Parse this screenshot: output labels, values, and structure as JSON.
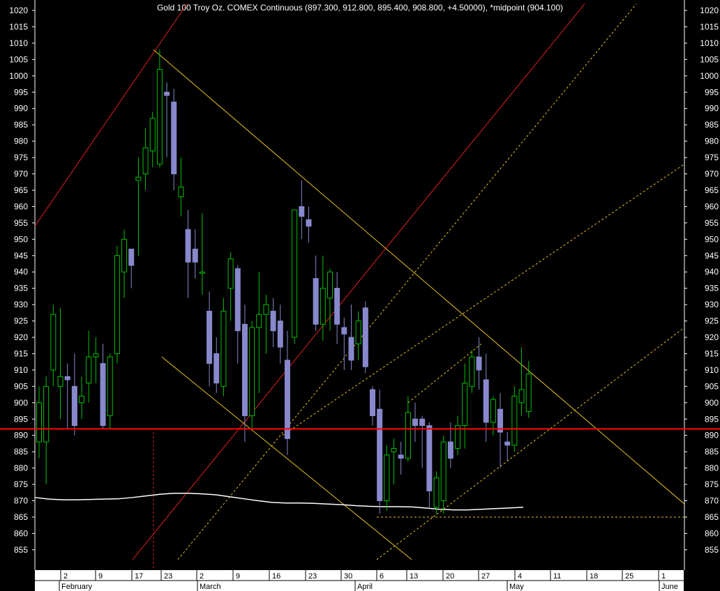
{
  "title": "Gold 100 Troy Oz. COMEX Continuous (897.300, 912.800, 895.400, 908.800, +4.50000), *midpoint (904.100)",
  "colors": {
    "background": "#000000",
    "bull_candle": "#00c000",
    "bear_candle": "#8888cc",
    "support_line": "#ff0000",
    "trend_red": "#dd2020",
    "trend_yellow": "#e8c020",
    "midpoint_line": "#ffffff",
    "axis_text": "#ffffff",
    "date_bar": "#ffffff"
  },
  "chart_data": {
    "type": "candlestick",
    "title": "Gold 100 Troy Oz. COMEX Continuous (897.300, 912.800, 895.400, 908.800, +4.50000), *midpoint (904.100)",
    "ylim": [
      852,
      1022
    ],
    "y_ticks": [
      855,
      860,
      865,
      870,
      875,
      880,
      885,
      890,
      895,
      900,
      905,
      910,
      915,
      920,
      925,
      930,
      935,
      940,
      945,
      950,
      955,
      960,
      965,
      970,
      975,
      980,
      985,
      990,
      995,
      1000,
      1005,
      1010,
      1015,
      1020
    ],
    "x_day_ticks": [
      "2",
      "9",
      "17",
      "23",
      "2",
      "9",
      "16",
      "23",
      "30",
      "6",
      "13",
      "20",
      "27",
      "4",
      "11",
      "18",
      "25",
      "1"
    ],
    "x_month_labels": [
      "February",
      "March",
      "April",
      "May",
      "June"
    ],
    "support_level": 892,
    "candles": [
      {
        "o": 888,
        "h": 905,
        "l": 883,
        "c": 900
      },
      {
        "o": 888,
        "h": 908,
        "l": 875,
        "c": 905
      },
      {
        "o": 910,
        "h": 930,
        "l": 905,
        "c": 927
      },
      {
        "o": 905,
        "h": 929,
        "l": 895,
        "c": 908
      },
      {
        "o": 908,
        "h": 912,
        "l": 892,
        "c": 907
      },
      {
        "o": 905,
        "h": 915,
        "l": 890,
        "c": 893
      },
      {
        "o": 900,
        "h": 908,
        "l": 895,
        "c": 902
      },
      {
        "o": 906,
        "h": 922,
        "l": 900,
        "c": 914
      },
      {
        "o": 914,
        "h": 920,
        "l": 906,
        "c": 915
      },
      {
        "o": 912,
        "h": 918,
        "l": 892,
        "c": 893
      },
      {
        "o": 896,
        "h": 915,
        "l": 892,
        "c": 914
      },
      {
        "o": 915,
        "h": 948,
        "l": 912,
        "c": 945
      },
      {
        "o": 940,
        "h": 953,
        "l": 932,
        "c": 950
      },
      {
        "o": 947,
        "h": 947,
        "l": 935,
        "c": 942
      },
      {
        "o": 968,
        "h": 975,
        "l": 945,
        "c": 969
      },
      {
        "o": 970,
        "h": 984,
        "l": 965,
        "c": 978
      },
      {
        "o": 977,
        "h": 989,
        "l": 972,
        "c": 987
      },
      {
        "o": 973,
        "h": 1008,
        "l": 972,
        "c": 1002
      },
      {
        "o": 995,
        "h": 998,
        "l": 975,
        "c": 994
      },
      {
        "o": 992,
        "h": 996,
        "l": 965,
        "c": 970
      },
      {
        "o": 963,
        "h": 975,
        "l": 957,
        "c": 966
      },
      {
        "o": 953,
        "h": 959,
        "l": 932,
        "c": 943
      },
      {
        "o": 947,
        "h": 953,
        "l": 938,
        "c": 943
      },
      {
        "o": 940,
        "h": 958,
        "l": 933,
        "c": 940
      },
      {
        "o": 928,
        "h": 934,
        "l": 905,
        "c": 912
      },
      {
        "o": 915,
        "h": 920,
        "l": 903,
        "c": 906
      },
      {
        "o": 905,
        "h": 932,
        "l": 902,
        "c": 928
      },
      {
        "o": 935,
        "h": 946,
        "l": 925,
        "c": 944
      },
      {
        "o": 941,
        "h": 942,
        "l": 912,
        "c": 922
      },
      {
        "o": 924,
        "h": 930,
        "l": 888,
        "c": 896
      },
      {
        "o": 896,
        "h": 925,
        "l": 892,
        "c": 923
      },
      {
        "o": 923,
        "h": 940,
        "l": 903,
        "c": 927
      },
      {
        "o": 927,
        "h": 933,
        "l": 915,
        "c": 930
      },
      {
        "o": 928,
        "h": 932,
        "l": 917,
        "c": 922
      },
      {
        "o": 925,
        "h": 930,
        "l": 912,
        "c": 917
      },
      {
        "o": 913,
        "h": 922,
        "l": 884,
        "c": 889
      },
      {
        "o": 920,
        "h": 955,
        "l": 918,
        "c": 959
      },
      {
        "o": 960,
        "h": 968,
        "l": 950,
        "c": 957
      },
      {
        "o": 956,
        "h": 960,
        "l": 949,
        "c": 954
      },
      {
        "o": 938,
        "h": 945,
        "l": 922,
        "c": 924
      },
      {
        "o": 924,
        "h": 945,
        "l": 919,
        "c": 935
      },
      {
        "o": 932,
        "h": 941,
        "l": 922,
        "c": 940
      },
      {
        "o": 935,
        "h": 940,
        "l": 918,
        "c": 924
      },
      {
        "o": 923,
        "h": 926,
        "l": 910,
        "c": 921
      },
      {
        "o": 920,
        "h": 930,
        "l": 910,
        "c": 913
      },
      {
        "o": 918,
        "h": 928,
        "l": 913,
        "c": 925
      },
      {
        "o": 929,
        "h": 931,
        "l": 909,
        "c": 911
      },
      {
        "o": 904,
        "h": 905,
        "l": 893,
        "c": 896
      },
      {
        "o": 898,
        "h": 904,
        "l": 866,
        "c": 870
      },
      {
        "o": 870,
        "h": 887,
        "l": 867,
        "c": 884
      },
      {
        "o": 885,
        "h": 889,
        "l": 875,
        "c": 886
      },
      {
        "o": 884,
        "h": 888,
        "l": 878,
        "c": 883
      },
      {
        "o": 883,
        "h": 902,
        "l": 882,
        "c": 897
      },
      {
        "o": 895,
        "h": 900,
        "l": 888,
        "c": 893
      },
      {
        "o": 895,
        "h": 896,
        "l": 880,
        "c": 893
      },
      {
        "o": 893,
        "h": 894,
        "l": 868,
        "c": 873
      },
      {
        "o": 868,
        "h": 879,
        "l": 866,
        "c": 877
      },
      {
        "o": 870,
        "h": 890,
        "l": 866,
        "c": 888
      },
      {
        "o": 888,
        "h": 894,
        "l": 880,
        "c": 883
      },
      {
        "o": 886,
        "h": 896,
        "l": 884,
        "c": 893
      },
      {
        "o": 893,
        "h": 912,
        "l": 886,
        "c": 906
      },
      {
        "o": 905,
        "h": 916,
        "l": 903,
        "c": 914
      },
      {
        "o": 914,
        "h": 920,
        "l": 904,
        "c": 910
      },
      {
        "o": 907,
        "h": 915,
        "l": 888,
        "c": 894
      },
      {
        "o": 894,
        "h": 902,
        "l": 890,
        "c": 901
      },
      {
        "o": 898,
        "h": 903,
        "l": 880,
        "c": 891
      },
      {
        "o": 888,
        "h": 891,
        "l": 882,
        "c": 887
      },
      {
        "o": 887,
        "h": 905,
        "l": 885,
        "c": 902
      },
      {
        "o": 900,
        "h": 917,
        "l": 896,
        "c": 904
      },
      {
        "o": 897.3,
        "h": 912.8,
        "l": 895.4,
        "c": 908.8
      }
    ],
    "midpoint_series": [
      871,
      870.5,
      870.3,
      870.3,
      870.4,
      870.5,
      870.6,
      871,
      871.5,
      872,
      872.3,
      872.3,
      872.1,
      871.8,
      871.2,
      870.6,
      870,
      869.5,
      869.3,
      869.3,
      869.2,
      869,
      868.8,
      868.5,
      868.3,
      868.2,
      868.2,
      868.1,
      867.8,
      867.4,
      867.2,
      867.2,
      867.4,
      867.6,
      867.8,
      868
    ]
  }
}
